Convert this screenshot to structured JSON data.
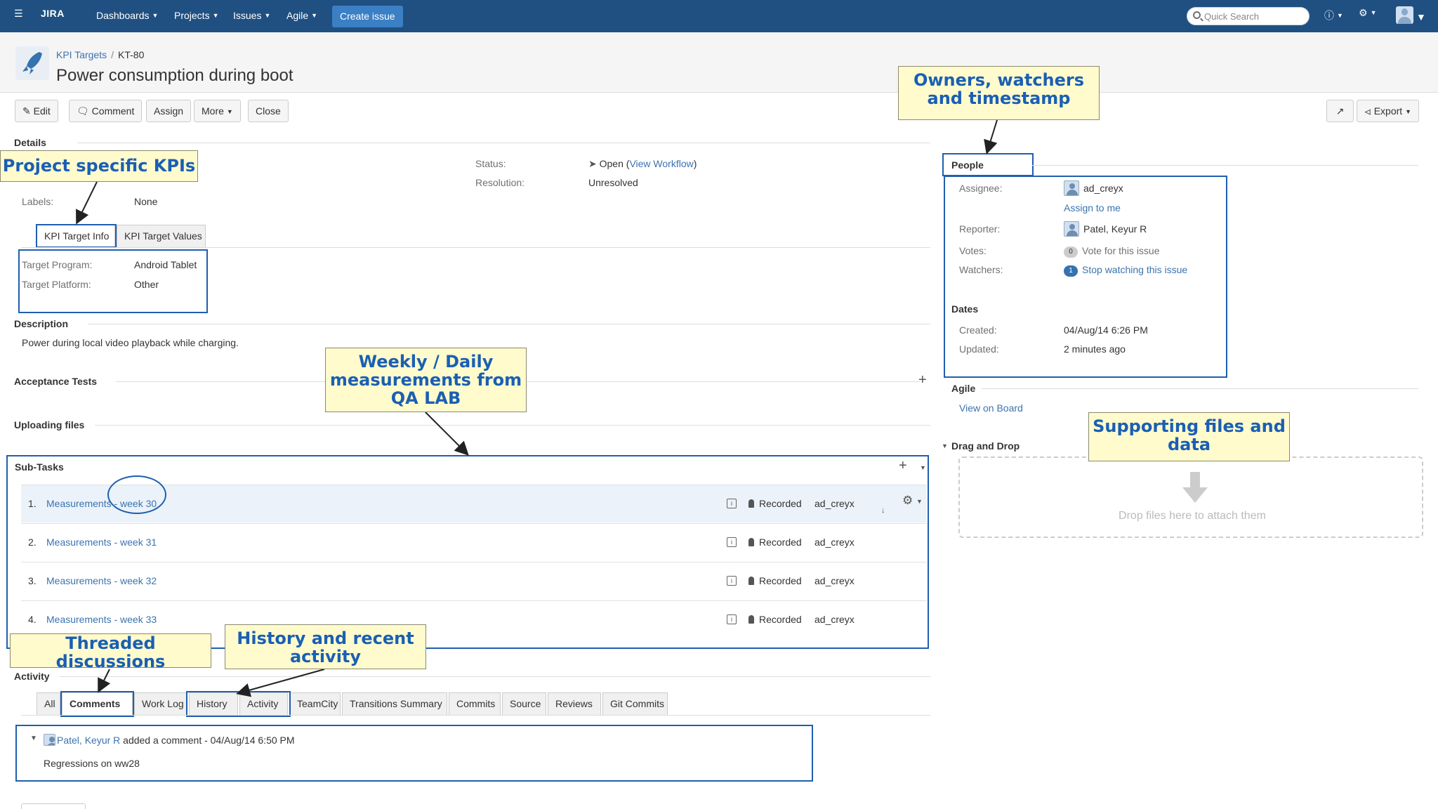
{
  "nav": {
    "logo": "JIRA",
    "items": [
      "Dashboards",
      "Projects",
      "Issues",
      "Agile"
    ],
    "create_issue": "Create issue",
    "search_placeholder": "Quick Search"
  },
  "header": {
    "project": "KPI Targets",
    "issue_key": "KT-80",
    "title": "Power consumption during boot"
  },
  "toolbar": {
    "edit": "Edit",
    "comment": "Comment",
    "assign": "Assign",
    "more": "More",
    "close": "Close",
    "export": "Export"
  },
  "details": {
    "heading": "Details",
    "labels_label": "Labels:",
    "labels_value": "None",
    "status_label": "Status:",
    "status_value": "Open",
    "view_workflow": "View Workflow",
    "resolution_label": "Resolution:",
    "resolution_value": "Unresolved"
  },
  "kpi_tabs": [
    "KPI Target Info",
    "KPI Target Values"
  ],
  "kpi_fields": [
    {
      "label": "Target Program:",
      "value": "Android Tablet"
    },
    {
      "label": "Target Platform:",
      "value": "Other"
    }
  ],
  "description": {
    "heading": "Description",
    "text": "Power during local video playback while charging."
  },
  "acceptance_tests": "Acceptance Tests",
  "uploading_files": "Uploading files",
  "subtasks": {
    "heading": "Sub-Tasks",
    "rows": [
      {
        "num": "1.",
        "name": "Measurements - week 30",
        "status": "Recorded",
        "assignee": "ad_creyx"
      },
      {
        "num": "2.",
        "name": "Measurements - week 31",
        "status": "Recorded",
        "assignee": "ad_creyx"
      },
      {
        "num": "3.",
        "name": "Measurements - week 32",
        "status": "Recorded",
        "assignee": "ad_creyx"
      },
      {
        "num": "4.",
        "name": "Measurements - week 33",
        "status": "Recorded",
        "assignee": "ad_creyx"
      }
    ]
  },
  "activity": {
    "heading": "Activity",
    "tabs": [
      "All",
      "Comments",
      "Work Log",
      "History",
      "Activity",
      "TeamCity",
      "Transitions Summary",
      "Commits",
      "Source",
      "Reviews",
      "Git Commits"
    ],
    "comment": {
      "author": "Patel, Keyur R",
      "meta": " added a comment - 04/Aug/14 6:50 PM",
      "body": "Regressions on ww28"
    }
  },
  "people": {
    "heading": "People",
    "assignee_label": "Assignee:",
    "assignee": "ad_creyx",
    "assign_to_me": "Assign to me",
    "reporter_label": "Reporter:",
    "reporter": "Patel, Keyur R",
    "votes_label": "Votes:",
    "votes_count": "0",
    "vote_link": "Vote for this issue",
    "watchers_label": "Watchers:",
    "watchers_count": "1",
    "watch_link": "Stop watching this issue"
  },
  "dates": {
    "heading": "Dates",
    "created_label": "Created:",
    "created": "04/Aug/14 6:26 PM",
    "updated_label": "Updated:",
    "updated": "2 minutes ago"
  },
  "agile": {
    "heading": "Agile",
    "link": "View on Board"
  },
  "drag_drop": {
    "heading": "Drag and Drop",
    "text": "Drop files here to attach them"
  },
  "callouts": {
    "owners": "Owners, watchers and timestamp",
    "kpis": "Project specific KPIs",
    "weekly": "Weekly / Daily measurements from QA LAB",
    "supporting": "Supporting files and data",
    "threaded": "Threaded discussions",
    "history": "History and recent activity"
  }
}
